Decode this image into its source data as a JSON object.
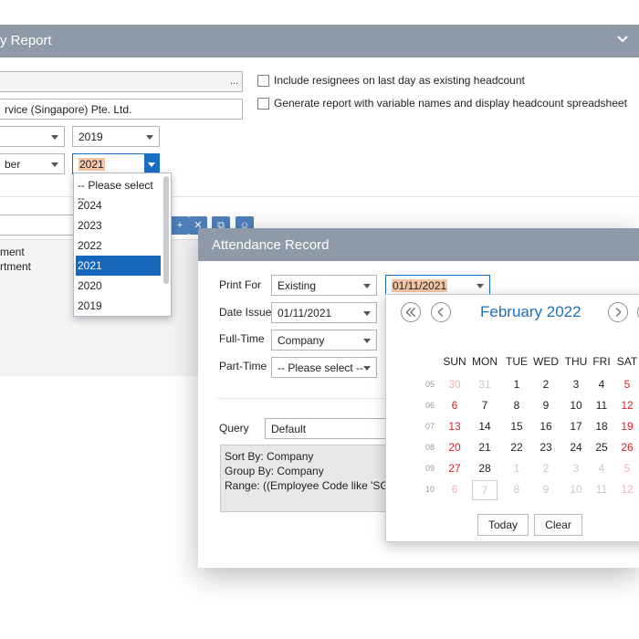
{
  "report": {
    "title": "y Report",
    "company_name": "rvice (Singapore) Pte. Ltd.",
    "ellipsis": "...",
    "year_from": "2019",
    "month_to": "ber",
    "year_to": "2021",
    "include_resignees": "Include resignees on last day as existing headcount",
    "generate_variable": "Generate report with variable names and display headcount spreadsheet",
    "list_items": [
      "ment",
      "rtment"
    ],
    "year_options": [
      "-- Please select --",
      "2024",
      "2023",
      "2022",
      "2021",
      "2020",
      "2019"
    ],
    "year_selected": "2021"
  },
  "attendance": {
    "title": "Attendance Record",
    "print_for": {
      "label": "Print For",
      "value": "Existing",
      "date": "01/11/2021"
    },
    "date_issue": {
      "label": "Date Issue",
      "value": "01/11/2021"
    },
    "full_time": {
      "label": "Full-Time",
      "value": "Company"
    },
    "part_time": {
      "label": "Part-Time",
      "value": "-- Please select --"
    },
    "query": {
      "label": "Query",
      "value": "Default"
    },
    "query_text": [
      "Sort By: Company",
      "Group By: Company",
      "Range: ((Employee Code like 'SG%'"
    ]
  },
  "calendar": {
    "month_label": "February 2022",
    "weekdays": [
      "SUN",
      "MON",
      "TUE",
      "WED",
      "THU",
      "FRI",
      "SAT"
    ],
    "weeks": [
      {
        "wk": "05",
        "days": [
          {
            "d": "30",
            "o": true
          },
          {
            "d": "31",
            "o": true
          },
          {
            "d": "1"
          },
          {
            "d": "2"
          },
          {
            "d": "3"
          },
          {
            "d": "4"
          },
          {
            "d": "5"
          }
        ]
      },
      {
        "wk": "06",
        "days": [
          {
            "d": "6"
          },
          {
            "d": "7"
          },
          {
            "d": "8"
          },
          {
            "d": "9"
          },
          {
            "d": "10"
          },
          {
            "d": "11"
          },
          {
            "d": "12"
          }
        ]
      },
      {
        "wk": "07",
        "days": [
          {
            "d": "13"
          },
          {
            "d": "14"
          },
          {
            "d": "15"
          },
          {
            "d": "16"
          },
          {
            "d": "17"
          },
          {
            "d": "18"
          },
          {
            "d": "19"
          }
        ]
      },
      {
        "wk": "08",
        "days": [
          {
            "d": "20"
          },
          {
            "d": "21"
          },
          {
            "d": "22"
          },
          {
            "d": "23"
          },
          {
            "d": "24"
          },
          {
            "d": "25"
          },
          {
            "d": "26"
          }
        ]
      },
      {
        "wk": "09",
        "days": [
          {
            "d": "27"
          },
          {
            "d": "28"
          },
          {
            "d": "1",
            "o": true
          },
          {
            "d": "2",
            "o": true
          },
          {
            "d": "3",
            "o": true
          },
          {
            "d": "4",
            "o": true
          },
          {
            "d": "5",
            "o": true
          }
        ]
      },
      {
        "wk": "10",
        "days": [
          {
            "d": "6",
            "o": true
          },
          {
            "d": "7",
            "o": true,
            "t": true
          },
          {
            "d": "8",
            "o": true
          },
          {
            "d": "9",
            "o": true
          },
          {
            "d": "10",
            "o": true
          },
          {
            "d": "11",
            "o": true
          },
          {
            "d": "12",
            "o": true
          }
        ]
      }
    ],
    "today_label": "Today",
    "clear_label": "Clear"
  },
  "colors": {
    "header": "#8e9aa8",
    "accent": "#1f6fbf",
    "selected": "#1567bc",
    "weekend": "#d91f2b",
    "highlight": "#f4c6a5"
  }
}
